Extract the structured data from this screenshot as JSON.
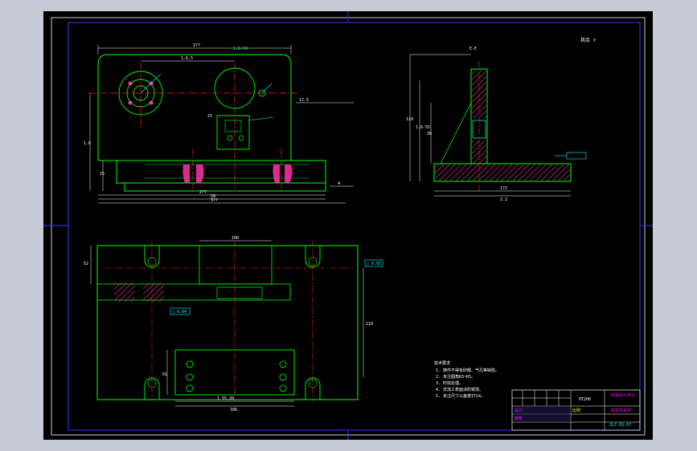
{
  "colors": {
    "background": "#c6ccd6",
    "sheet": "#000000",
    "outline": "#00ff00",
    "dimension": "#ffffff",
    "centerline": "#ff2020",
    "hatch": "#ff33aa",
    "frame": "#3333ff",
    "cyan": "#00ffff",
    "yellow": "#ffff33",
    "magenta": "#ff00ff"
  },
  "front_view": {
    "dims": {
      "overall_width": "2??",
      "center_label": "1.6-10",
      "left_offset": "1.6.5",
      "base_width": "2??",
      "slot_width": "28",
      "base_length": "3??",
      "right_gap": "17.5",
      "height": "1.6",
      "base_height": "25",
      "tol": "4",
      "small": "25"
    }
  },
  "side_view": {
    "section_label": "E-E",
    "dims": {
      "height": "110",
      "partial": "1.6-55",
      "inner": "30",
      "base_width": "172",
      "overall_width": "2.2"
    }
  },
  "top_view": {
    "dims": {
      "slot_span": "100",
      "left_height": "52",
      "right_height": "110",
      "pad_width": "1 55.20",
      "pad_width2": "186",
      "pad_height": "61"
    },
    "callouts": [
      "□ 0.05",
      "□ 0.04"
    ]
  },
  "roughness_label": "其余 ▽",
  "notes": {
    "title": "技术要求",
    "items": [
      "1. 铸件不得有砂眼、气孔等缺陷。",
      "2. 未注圆角R3~R5。",
      "3. 时效处理。",
      "4. 非加工表面涂防锈漆。",
      "5. 未注尺寸公差按IT14。"
    ]
  },
  "title_block": {
    "material": "HT200",
    "name": "铣床夹具体",
    "school": "机械设计专业",
    "drawing_no": "ZL7-03-07",
    "scale_label": "比例",
    "designer": "设计",
    "checker": "审核"
  }
}
